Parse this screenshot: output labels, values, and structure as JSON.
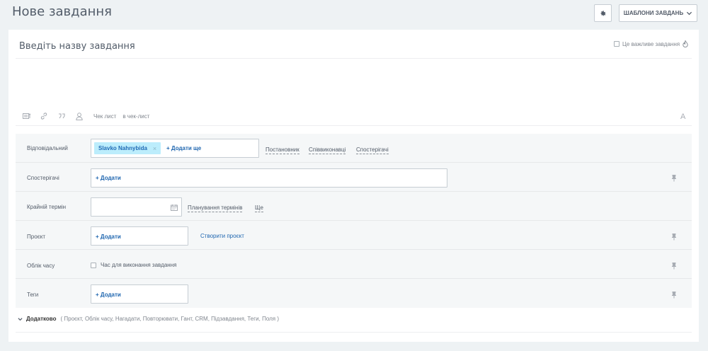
{
  "header": {
    "title": "Нове завдання",
    "templates_label": "ШАБЛОНИ ЗАВДАНЬ"
  },
  "task": {
    "title_placeholder": "Введіть назву завдання",
    "important_label": "Це важливе завдання"
  },
  "editor": {
    "checklist_label": "Чек лист",
    "to_checklist_label": "в чек-лист",
    "font_label": "A"
  },
  "fields": {
    "responsible": {
      "label": "Відповідальний",
      "assignee": "Slavko Nahnybida",
      "add_more": "+ Додати ще",
      "links": [
        "Постановник",
        "Співвиконавці",
        "Спостерігачі"
      ]
    },
    "observers": {
      "label": "Спостерігачі",
      "add": "+ Додати"
    },
    "deadline": {
      "label": "Крайній термін",
      "planning": "Планування термінів",
      "more": "Ще"
    },
    "project": {
      "label": "Проєкт",
      "add": "+ Додати",
      "create": "Створити проєкт"
    },
    "time": {
      "label": "Облік часу",
      "checkbox_label": "Час для виконання завдання"
    },
    "tags": {
      "label": "Теги",
      "add": "+ Додати"
    }
  },
  "extra": {
    "toggle_label": "Додатково",
    "items_text": "( Проєкт,  Облік часу,  Нагадати,  Повторювати,  Гант,  CRM,  Підзавдання,  Теги,  Поля )"
  },
  "colors": {
    "accent": "#2067b0",
    "tag_bg": "#bcedfc",
    "background": "#eef2f4"
  }
}
